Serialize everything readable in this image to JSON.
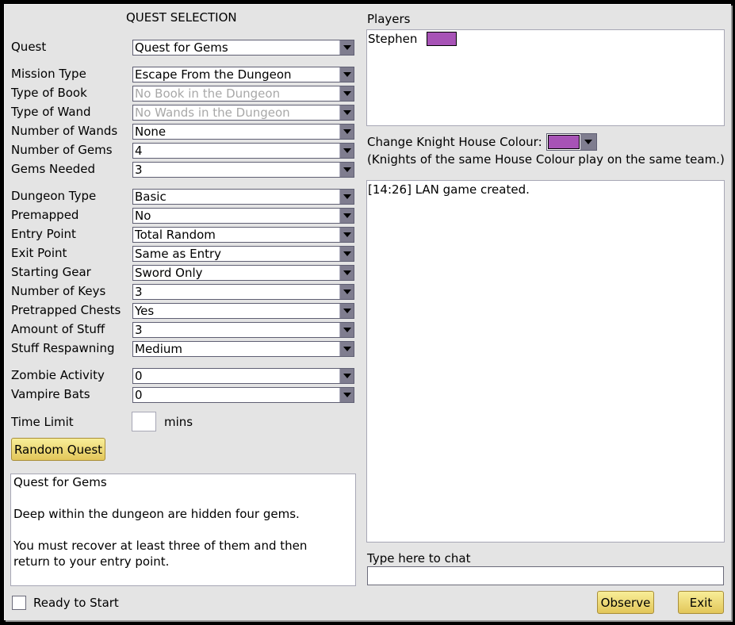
{
  "quest_selection": {
    "title": "QUEST SELECTION",
    "fields": [
      {
        "label": "Quest",
        "value": "Quest for Gems",
        "disabled": false
      },
      {
        "label": "Mission Type",
        "value": "Escape From the Dungeon",
        "disabled": false
      },
      {
        "label": "Type of Book",
        "value": "No Book in the Dungeon",
        "disabled": true
      },
      {
        "label": "Type of Wand",
        "value": "No Wands in the Dungeon",
        "disabled": true
      },
      {
        "label": "Number of Wands",
        "value": "None",
        "disabled": false
      },
      {
        "label": "Number of Gems",
        "value": "4",
        "disabled": false
      },
      {
        "label": "Gems Needed",
        "value": "3",
        "disabled": false
      },
      {
        "label": "Dungeon Type",
        "value": "Basic",
        "disabled": false
      },
      {
        "label": "Premapped",
        "value": "No",
        "disabled": false
      },
      {
        "label": "Entry Point",
        "value": "Total Random",
        "disabled": false
      },
      {
        "label": "Exit Point",
        "value": "Same as Entry",
        "disabled": false
      },
      {
        "label": "Starting Gear",
        "value": "Sword Only",
        "disabled": false
      },
      {
        "label": "Number of Keys",
        "value": "3",
        "disabled": false
      },
      {
        "label": "Pretrapped Chests",
        "value": "Yes",
        "disabled": false
      },
      {
        "label": "Amount of Stuff",
        "value": "3",
        "disabled": false
      },
      {
        "label": "Stuff Respawning",
        "value": "Medium",
        "disabled": false
      },
      {
        "label": "Zombie Activity",
        "value": "0",
        "disabled": false
      },
      {
        "label": "Vampire Bats",
        "value": "0",
        "disabled": false
      }
    ],
    "time_limit": {
      "label": "Time Limit",
      "value": "",
      "unit": "mins"
    },
    "random_quest_label": "Random Quest",
    "description": {
      "lines": [
        "Quest for Gems",
        "",
        "Deep within the dungeon are hidden four gems.",
        "",
        "You must recover at least three of them and then",
        "return to your entry point."
      ]
    },
    "ready_to_start": {
      "label": "Ready to Start",
      "checked": false
    }
  },
  "players": {
    "title": "Players",
    "list": [
      {
        "name": "Stephen",
        "colour": "#a753b6"
      }
    ]
  },
  "house_colour": {
    "label": "Change Knight House Colour:",
    "value": "#a753b6",
    "note": "(Knights of the same House Colour play on the same team.)"
  },
  "chat": {
    "log": [
      "[14:26] LAN game created."
    ],
    "input_label": "Type here to chat",
    "input_value": ""
  },
  "buttons": {
    "observe": "Observe",
    "exit": "Exit"
  },
  "colors": {
    "panel_bg": "#e4e4e4",
    "button_gold": "#e9d46e",
    "arrow_bg": "#7f7d8f",
    "house_colour": "#a753b6"
  }
}
